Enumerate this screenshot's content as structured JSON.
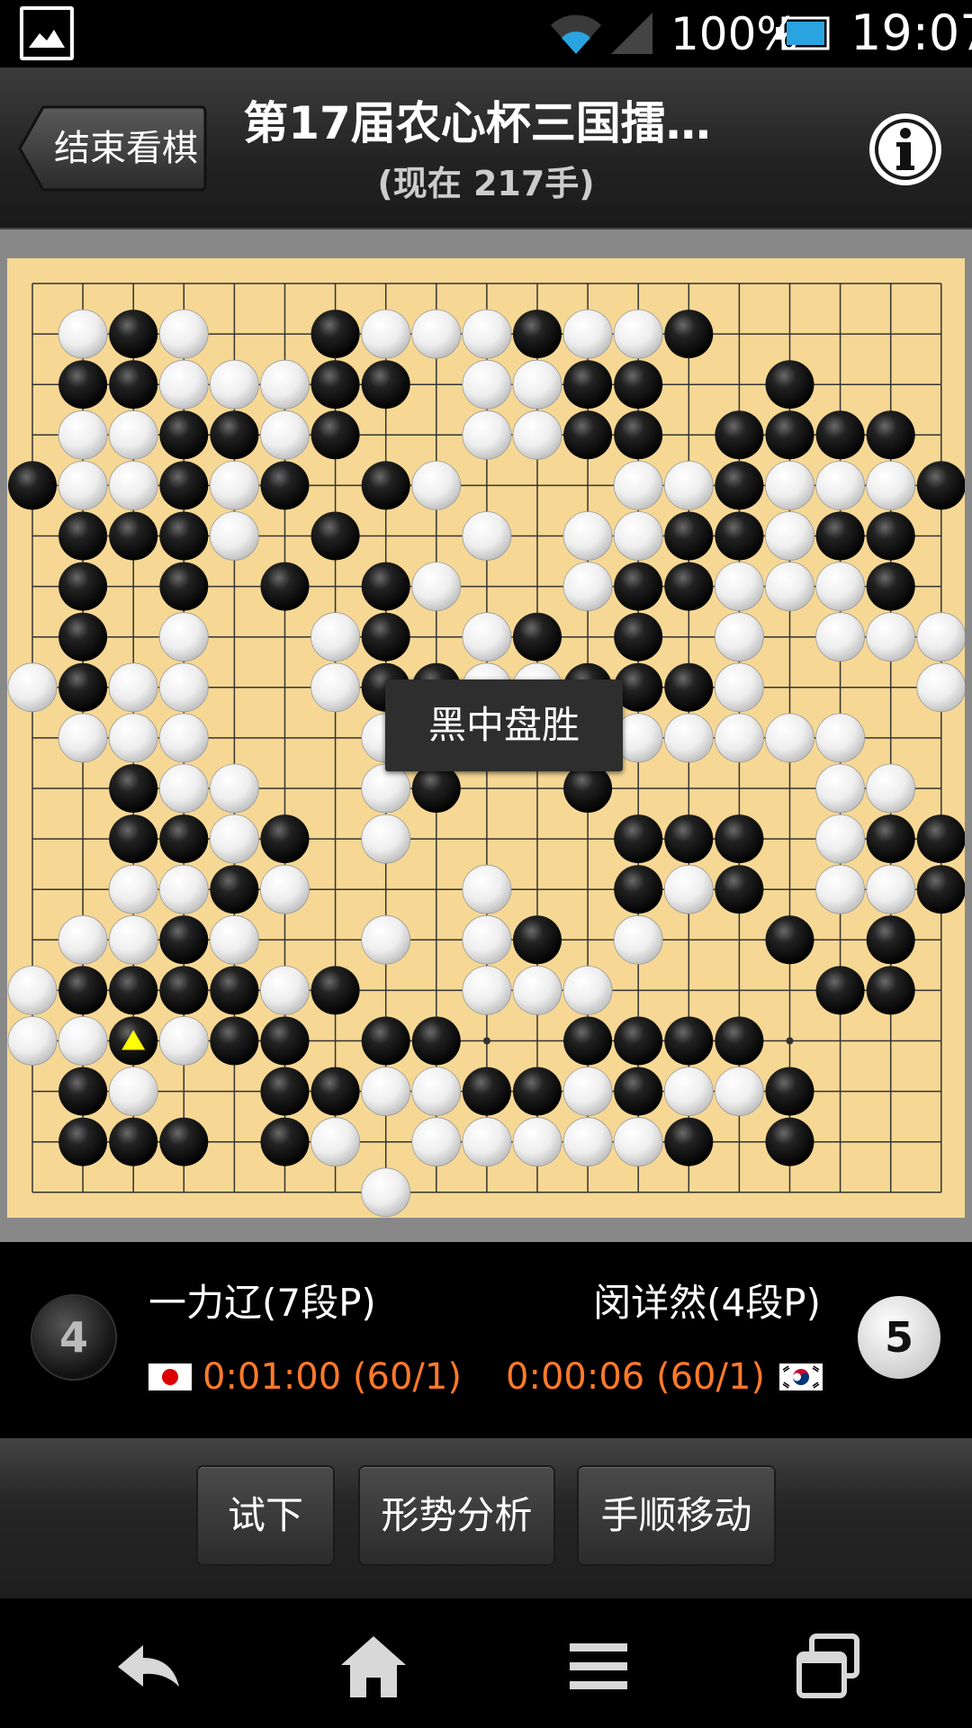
{
  "status_bar": {
    "battery_percent": "100%",
    "time": "19:07",
    "icons": [
      "gallery-icon",
      "wifi-icon",
      "signal-icon",
      "battery-icon"
    ]
  },
  "header": {
    "back_label": "结束看棋",
    "title": "第17届农心杯三国擂…",
    "subtitle": "(现在 217手)",
    "info_icon": "info-icon"
  },
  "board": {
    "size": 19,
    "colors": {
      "wood": "#f6d894",
      "line": "#333333",
      "last_move_marker": "#ffff00"
    },
    "last_move": [
      2,
      15
    ],
    "rows": [
      "...................",
      ".WBW..BWWWBWWB.....",
      ".BBWWWBB.WWBB..B...",
      ".WWBBWB..WWBB.BBBB.",
      "BWWBWB.BW...WWBWWWB",
      ".BBBW.B..W.WWBBWBB.",
      ".B.B.B.BW..WBBWWWB.",
      ".B.W..WB.WB.B.W.WWW",
      "WBWW..WBBWWBBBW...W",
      ".WWW...WB.BWWWWWW..",
      "..BWW..WB..B....WW.",
      "..BBWB.W....BBB.WBBW",
      "..WWBW...W..BWB.WWB.",
      ".WWBW..W.WB.W..B.B.B",
      "WBBBBWB..WWW....BB.",
      "WWBWBB.BB..BBBB....",
      ".BW..BBWWBBWBWWB...",
      ".BBB.BW.WWWWWB.B...",
      ".......W..........."
    ]
  },
  "result": {
    "text": "黑中盘胜"
  },
  "players": {
    "black": {
      "name": "一力辽(7段P)",
      "time": "0:01:00 (60/1)",
      "captures": "4",
      "flag": "japan-flag"
    },
    "white": {
      "name": "闵详然(4段P)",
      "time": "0:00:06 (60/1)",
      "captures": "5",
      "flag": "korea-flag"
    }
  },
  "toolbar": {
    "try_label": "试下",
    "analysis_label": "形势分析",
    "move_label": "手顺移动"
  },
  "navbar": {
    "icons": [
      "back-icon",
      "home-icon",
      "menu-icon",
      "recent-apps-icon"
    ]
  }
}
